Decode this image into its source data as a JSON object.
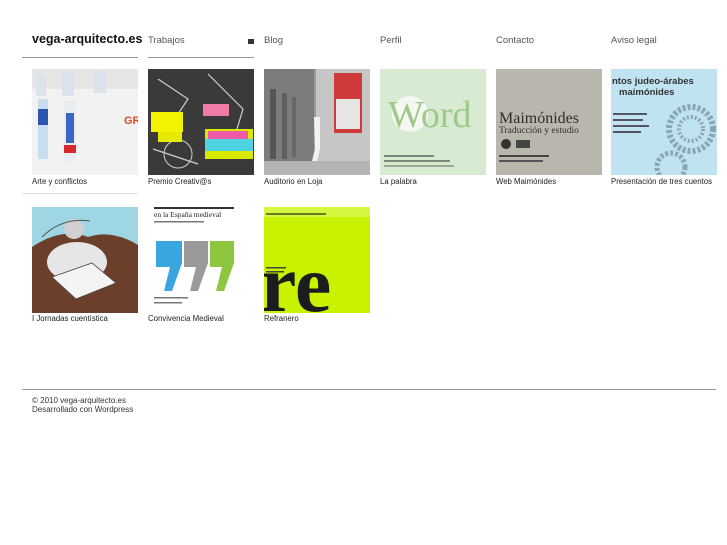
{
  "site": {
    "logo": "vega-arquitecto.es"
  },
  "nav": {
    "items": [
      {
        "label": "Trabajos"
      },
      {
        "label": "Blog"
      },
      {
        "label": "Perfil"
      },
      {
        "label": "Contacto"
      },
      {
        "label": "Aviso legal"
      }
    ]
  },
  "works": [
    {
      "caption": "Arte y conflictos",
      "thumb_text": "GR M"
    },
    {
      "caption": "Premio Creativ@s"
    },
    {
      "caption": "Auditorio en Loja"
    },
    {
      "caption": "La palabra",
      "thumb_text": "Word"
    },
    {
      "caption": "Web Maimónides",
      "thumb_title": "Maimónides",
      "thumb_sub": "Traducción y estudio"
    },
    {
      "caption": "Presentación de tres cuentos",
      "thumb_title": "ntos judeo-árabes",
      "thumb_sub": "maimónides"
    },
    {
      "caption": "I Jornadas cuentística"
    },
    {
      "caption": "Convivencia Medieval",
      "thumb_text": "en la España medieval"
    },
    {
      "caption": "Refranero",
      "thumb_text": "re"
    }
  ],
  "footer": {
    "copyright": "© 2010 vega-arquitecto.es",
    "credit": "Desarrollado con Wordpress"
  },
  "colors": {
    "accent_green": "#c8f200",
    "light_green": "#d7ebd2",
    "sky": "#bfe3f0"
  }
}
